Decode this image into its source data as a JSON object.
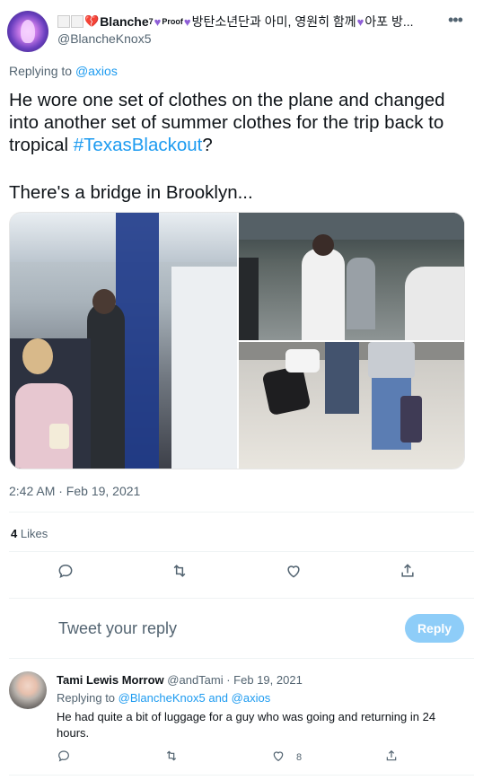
{
  "tweet": {
    "author": {
      "name": "Blanche",
      "name_suffix": "7",
      "proof_label": "Proof",
      "korean_text": "방탄소년단과 아미, 영원히 함께",
      "korean_tail": "아포 방...",
      "handle": "@BlancheKnox5"
    },
    "replying_label": "Replying to",
    "replying_to": "@axios",
    "text_line1": "He wore one set of clothes on the plane and changed into another set of summer clothes for the trip back to tropical ",
    "hashtag": "#TexasBlackout",
    "text_tail": "?",
    "text_line2": "There's a bridge in Brooklyn...",
    "timestamp": "2:42 AM · Feb 19, 2021",
    "likes_count": "4",
    "likes_label": "Likes"
  },
  "reply_box": {
    "placeholder": "Tweet your reply",
    "button_label": "Reply"
  },
  "reply": {
    "name": "Tami Lewis Morrow",
    "meta": "@andTami · Feb 19, 2021",
    "replying_label": "Replying to",
    "mention1": "@BlancheKnox5",
    "and_label": "and",
    "mention2": "@axios",
    "text": "He had quite a bit of luggage for a guy who was going and returning in 24 hours.",
    "like_count": "8"
  },
  "colors": {
    "accent": "#1d9bf0",
    "muted": "#536471",
    "reply_button": "#8ecdf8"
  },
  "icons": [
    "more-icon",
    "reply-icon",
    "retweet-icon",
    "like-icon",
    "share-icon"
  ]
}
